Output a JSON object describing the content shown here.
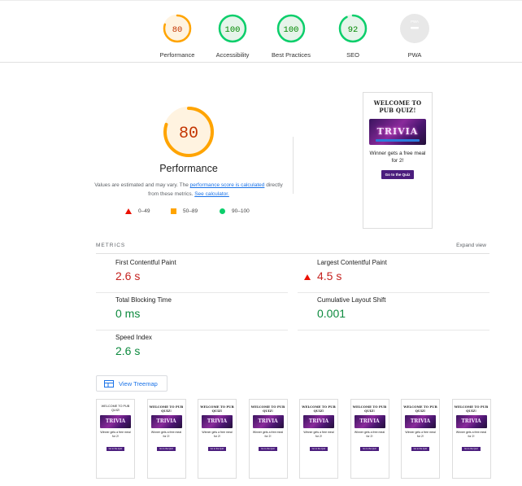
{
  "summary": {
    "categories": [
      {
        "key": "performance",
        "score": "80",
        "label": "Performance",
        "color": "#ffa400",
        "track": "#fff3e0",
        "fill": 0.8
      },
      {
        "key": "accessibility",
        "score": "100",
        "label": "Accessibility",
        "color": "#0cce6b",
        "track": "#e6f4ea",
        "fill": 1.0
      },
      {
        "key": "best-practices",
        "score": "100",
        "label": "Best Practices",
        "color": "#0cce6b",
        "track": "#e6f4ea",
        "fill": 1.0
      },
      {
        "key": "seo",
        "score": "92",
        "label": "SEO",
        "color": "#0cce6b",
        "track": "#e6f4ea",
        "fill": 0.92
      },
      {
        "key": "pwa",
        "score": "PWA",
        "label": "PWA",
        "color": "#c4c4c4",
        "track": "#e0e0e0",
        "fill": 0
      }
    ]
  },
  "performance": {
    "score": "80",
    "title": "Performance",
    "desc_prefix": "Values are estimated and may vary. The ",
    "link_score": "performance score is calculated",
    "desc_middle": " directly from these metrics. ",
    "link_calc": "See calculator.",
    "legend": {
      "low": "0–49",
      "mid": "50–89",
      "high": "90–100"
    }
  },
  "screenshot": {
    "heading": "WELCOME TO PUB QUIZ!",
    "image_text": "TRIVIA",
    "body": "Winner gets a free meal for 2!",
    "button": "Go to the Quiz"
  },
  "metrics": {
    "heading": "METRICS",
    "expand": "Expand view",
    "items": [
      {
        "name": "First Contentful Paint",
        "value": "2.6 s",
        "status": "average"
      },
      {
        "name": "Largest Contentful Paint",
        "value": "4.5 s",
        "status": "fail"
      },
      {
        "name": "Total Blocking Time",
        "value": "0 ms",
        "status": "pass"
      },
      {
        "name": "Cumulative Layout Shift",
        "value": "0.001",
        "status": "pass"
      },
      {
        "name": "Speed Index",
        "value": "2.6 s",
        "status": "pass"
      }
    ]
  },
  "treemap": {
    "label": "View Treemap"
  },
  "filmstrip": {
    "frames": [
      {
        "heading": "WELCOME TO PUB QUIZ!",
        "body": "Winner gets a free meal for 2!",
        "button": "Go to the Quiz",
        "plain": true
      },
      {
        "heading": "WELCOME TO PUB QUIZ!",
        "body": "Winner gets a free meal for 2!",
        "button": "Go to the Quiz",
        "plain": false
      },
      {
        "heading": "WELCOME TO PUB QUIZ!",
        "body": "Winner gets a free meal for 2!",
        "button": "Go to the Quiz",
        "plain": false
      },
      {
        "heading": "WELCOME TO PUB QUIZ!",
        "body": "Winner gets a free meal for 2!",
        "button": "Go to the Quiz",
        "plain": false
      },
      {
        "heading": "WELCOME TO PUB QUIZ!",
        "body": "Winner gets a free meal for 2!",
        "button": "Go to the Quiz",
        "plain": false
      },
      {
        "heading": "WELCOME TO PUB QUIZ!",
        "body": "Winner gets a free meal for 2!",
        "button": "Go to the Quiz",
        "plain": false
      },
      {
        "heading": "WELCOME TO PUB QUIZ!",
        "body": "Winner gets a free meal for 2!",
        "button": "Go to the Quiz",
        "plain": false
      },
      {
        "heading": "WELCOME TO PUB QUIZ!",
        "body": "Winner gets a free meal for 2!",
        "button": "Go to the Quiz",
        "plain": false
      }
    ]
  }
}
